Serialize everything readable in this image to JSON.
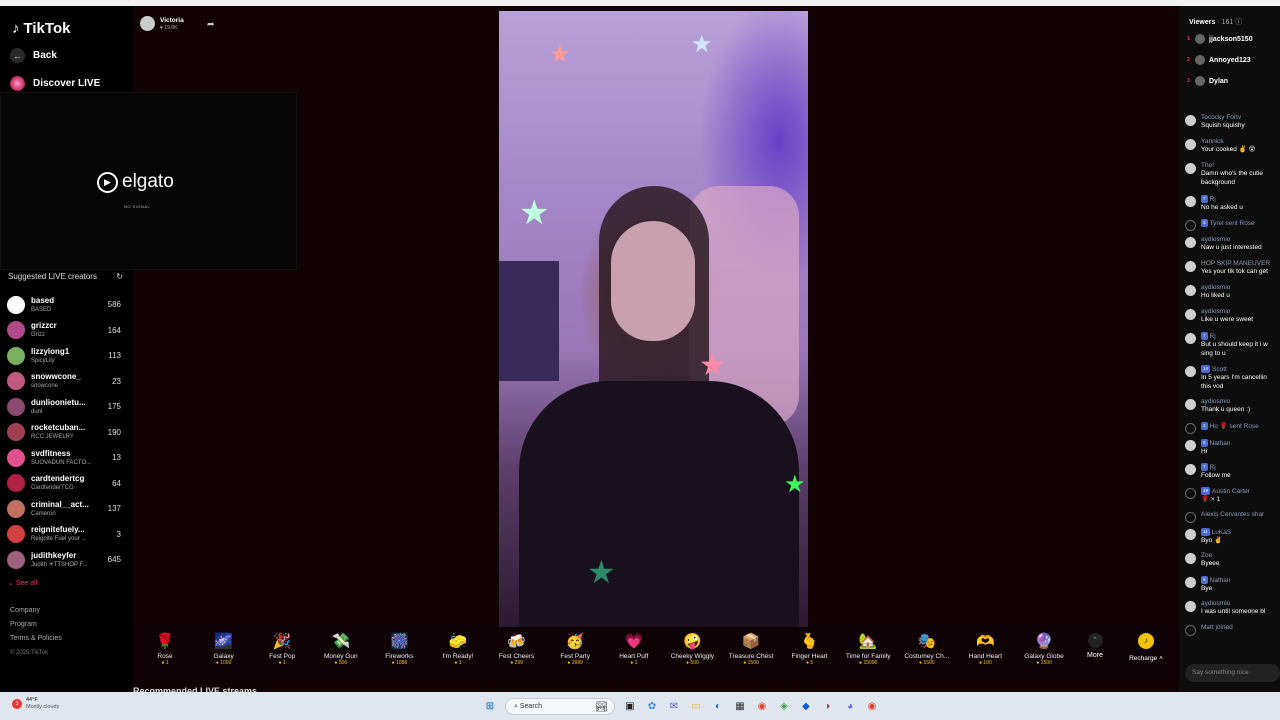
{
  "app": {
    "logo_text": "TikTok"
  },
  "sidebar": {
    "back_label": "Back",
    "discover_label": "Discover LIVE",
    "suggested_title": "Suggested LIVE creators",
    "creators": [
      {
        "name": "based",
        "sub": "BASED",
        "count": "586",
        "color": "#ffffff"
      },
      {
        "name": "grizzcr",
        "sub": "Grizz",
        "count": "164",
        "color": "#b04a8a"
      },
      {
        "name": "lizzylong1",
        "sub": "SpicyLily",
        "count": "113",
        "color": "#7ab060"
      },
      {
        "name": "snowwcone_",
        "sub": "snowcone",
        "count": "23",
        "color": "#c05a80"
      },
      {
        "name": "dunlioonietu...",
        "sub": "dunl",
        "count": "175",
        "color": "#8a4a70"
      },
      {
        "name": "rocketcuban...",
        "sub": "RCC JEWELRY",
        "count": "190",
        "color": "#a04050"
      },
      {
        "name": "svdfitness",
        "sub": "SUOVADUN FACTO...",
        "count": "13",
        "color": "#e0508a"
      },
      {
        "name": "cardtendertcg",
        "sub": "CardtenderTCG",
        "count": "64",
        "color": "#b02040"
      },
      {
        "name": "criminal__act...",
        "sub": "Cameron",
        "count": "137",
        "color": "#c07060"
      },
      {
        "name": "reignitefuely...",
        "sub": "Reignite Fuel your ...",
        "count": "3",
        "color": "#d04040"
      },
      {
        "name": "judithkeyfer",
        "sub": "Judith ✳TTSHOP F...",
        "count": "645",
        "color": "#a06080"
      }
    ],
    "see_all": "See all",
    "footer": [
      "Company",
      "Program",
      "Terms & Policies"
    ],
    "copyright": "© 2025 TikTok"
  },
  "capture": {
    "brand": "elgato",
    "status": "NO SIGNAL"
  },
  "stream": {
    "host_name": "Victoria",
    "host_likes": "♥ 19.8K"
  },
  "gifts": [
    {
      "name": "Rose",
      "price": "1",
      "icon": "🌹"
    },
    {
      "name": "Galaxy",
      "price": "1000",
      "icon": "🌌"
    },
    {
      "name": "Fest Pop",
      "price": "1",
      "icon": "🎉"
    },
    {
      "name": "Money Gun",
      "price": "500",
      "icon": "💸"
    },
    {
      "name": "Fireworks",
      "price": "1088",
      "icon": "🎆"
    },
    {
      "name": "I'm Ready!",
      "price": "1",
      "icon": "🧽"
    },
    {
      "name": "Fest Cheers",
      "price": "299",
      "icon": "🍻"
    },
    {
      "name": "Fest Party",
      "price": "2999",
      "icon": "🥳"
    },
    {
      "name": "Heart Puff",
      "price": "1",
      "icon": "💗"
    },
    {
      "name": "Cheeky Wiggly",
      "price": "500",
      "icon": "🤪"
    },
    {
      "name": "Treasure Chest",
      "price": "1500",
      "icon": "📦"
    },
    {
      "name": "Finger Heart",
      "price": "5",
      "icon": "🫰"
    },
    {
      "name": "Time for Family",
      "price": "15000",
      "icon": "🏡"
    },
    {
      "name": "Costumey Ch...",
      "price": "1500",
      "icon": "🎭"
    },
    {
      "name": "Hand Heart",
      "price": "100",
      "icon": "🫶"
    },
    {
      "name": "Galaxy Globe",
      "price": "1500",
      "icon": "🔮"
    }
  ],
  "more_label": "More",
  "recharge_label": "Recharge ˄",
  "recommended_title": "Recommended LIVE streams",
  "viewers": {
    "title": "Viewers",
    "count": "· 161 ⓘ",
    "top": [
      {
        "rank": "1",
        "name": "jjackson5150"
      },
      {
        "rank": "2",
        "name": "Annoyed123"
      },
      {
        "rank": "3",
        "name": "Dylan"
      }
    ]
  },
  "chat": [
    {
      "user": "Tococky Fortv",
      "text": "Squish squishy"
    },
    {
      "user": "Yannick",
      "text": "Your cooked ✌️ 😵"
    },
    {
      "user": "The!",
      "text": "Damn who's the cutie",
      "text2": "background"
    },
    {
      "user": "Rj",
      "text": "No he asked u",
      "badge": "7"
    },
    {
      "user": "Tyrel sent Rose",
      "text": "",
      "badge": "3",
      "system": true
    },
    {
      "user": "aydiosmio",
      "text": "Naw u just interested"
    },
    {
      "user": "HOP SKIP MANEUVER",
      "text": "Yes your tik tok can get"
    },
    {
      "user": "aydiosmio",
      "text": "Ho liked u"
    },
    {
      "user": "aydiosmio",
      "text": "Like u were sweet"
    },
    {
      "user": "Rj",
      "text": "But u should keep it i w",
      "text2": "sing to u",
      "badge": "7"
    },
    {
      "user": "Scott",
      "text": "In 5 years I'm cancellin",
      "text2": "this vod",
      "badge": "14"
    },
    {
      "user": "aydiosmio",
      "text": "Thank u queen :)"
    },
    {
      "user": "Ho 🌹 sent Rose",
      "text": "",
      "badge": "1",
      "system": true
    },
    {
      "user": "Nathan",
      "text": "Hi",
      "badge": "6"
    },
    {
      "user": "Rj",
      "text": "Follow me",
      "badge": "7"
    },
    {
      "user": "Austin Carter",
      "text": "🌹 × 1",
      "badge": "18",
      "system": true
    },
    {
      "user": "Alexis Cervantes shar",
      "text": "",
      "system": true
    },
    {
      "user": "LuKaS",
      "text": "Byo ✌️",
      "badge": "11"
    },
    {
      "user": "Zoe",
      "text": "Byeee"
    },
    {
      "user": "Nathan",
      "text": "Bye",
      "badge": "6"
    },
    {
      "user": "aydiosmio",
      "text": "I was until someone bl"
    },
    {
      "user": "Matt joined",
      "text": "",
      "system": true
    }
  ],
  "chat_placeholder": "Say something nice",
  "taskbar": {
    "temp": "44°F",
    "weather": "Mostly cloudy",
    "search": "Search"
  }
}
